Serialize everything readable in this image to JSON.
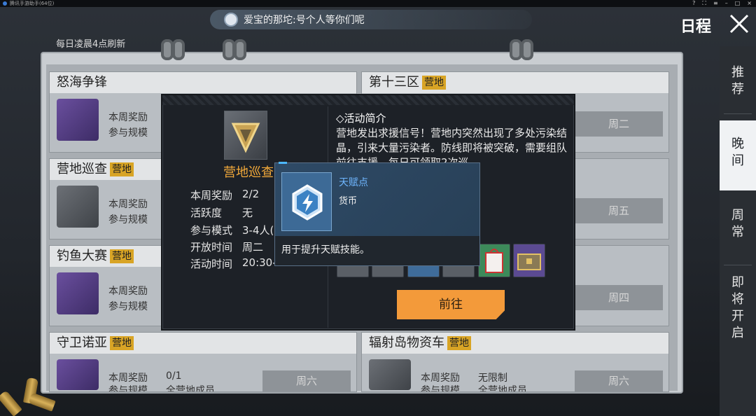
{
  "window": {
    "title": "腾讯手游助手(64位)"
  },
  "announcement": "爱宝的那坨:号个人等你们呢",
  "page_title": "日程",
  "refresh_note": "每日凌晨4点刷新",
  "sidenav": [
    {
      "label": "推荐",
      "active": false
    },
    {
      "label": "晚间",
      "active": true
    },
    {
      "label": "周常",
      "active": false
    },
    {
      "label": "即将开启",
      "active": false
    }
  ],
  "cards": [
    {
      "title": "怒海争锋",
      "badge": "",
      "reward_label": "本周奖励",
      "mode_label": "参与规模",
      "reward": "",
      "mode": "",
      "day": ""
    },
    {
      "title": "第十三区",
      "badge": "营地",
      "reward_label": "",
      "mode_label": "",
      "reward": "",
      "mode": "",
      "day": "周二"
    },
    {
      "title": "营地巡查",
      "badge": "营地",
      "reward_label": "本周奖励",
      "mode_label": "参与规模",
      "reward": "",
      "mode": "",
      "day": "周五"
    },
    {
      "title": "钓鱼大赛",
      "badge": "营地",
      "reward_label": "本周奖励",
      "mode_label": "参与规模",
      "reward": "",
      "mode": "",
      "day": "周四"
    },
    {
      "title": "守卫诺亚",
      "badge": "营地",
      "reward_label": "本周奖励",
      "mode_label": "参与规模",
      "reward": "0/1",
      "mode": "全营地成员",
      "day": "周六"
    },
    {
      "title": "辐射岛物资车",
      "badge": "营地",
      "reward_label": "本周奖励",
      "mode_label": "参与规模",
      "reward": "无限制",
      "mode": "全营地成员",
      "day": "周六"
    }
  ],
  "detail": {
    "name": "营地巡查",
    "rows": [
      {
        "label": "本周奖励",
        "value": "2/2"
      },
      {
        "label": "活跃度",
        "value": "无"
      },
      {
        "label": "参与模式",
        "value": "3-4人("
      },
      {
        "label": "开放时间",
        "value": "周二"
      },
      {
        "label": "活动时间",
        "value": "20:30-"
      }
    ],
    "intro_head": "◇活动简介",
    "intro_text": "营地发出求援信号！营地内突然出现了多处污染结晶，引来大量污染者。防线即将被突破，需要组队前往支援。每日可领取2次巡",
    "go_button": "前往"
  },
  "tooltip": {
    "name": "天赋点",
    "type": "货币",
    "desc": "用于提升天赋技能。"
  }
}
